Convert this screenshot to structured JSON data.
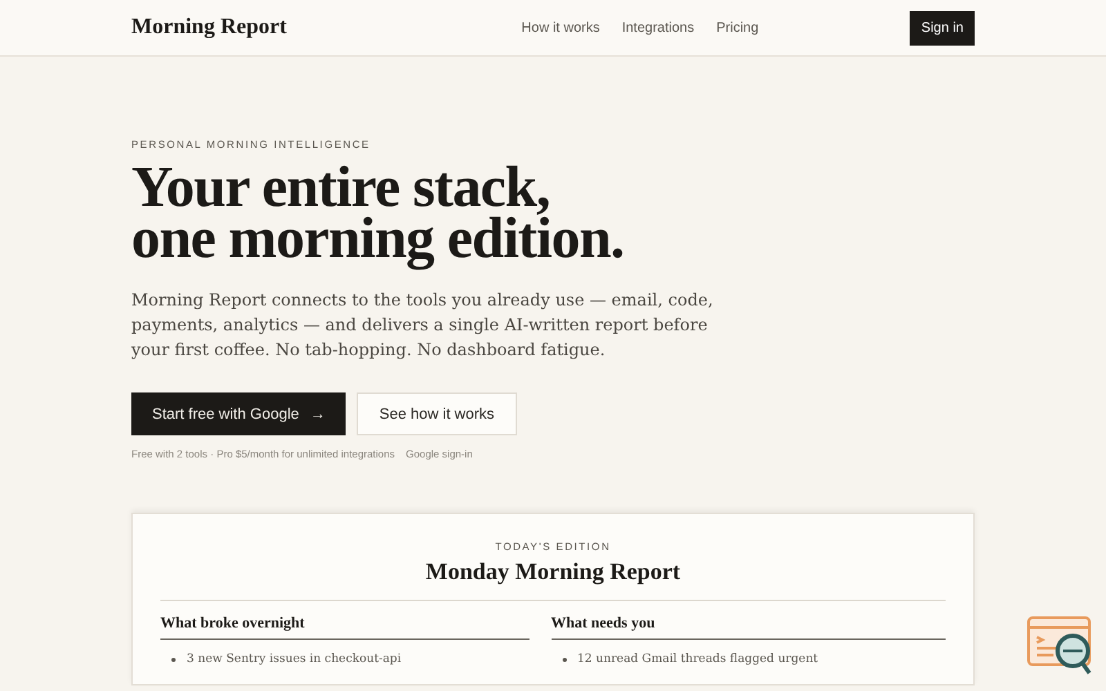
{
  "nav": {
    "brand": "Morning Report",
    "links": [
      "How it works",
      "Integrations",
      "Pricing"
    ],
    "sign_in": "Sign in"
  },
  "hero": {
    "eyebrow": "PERSONAL MORNING INTELLIGENCE",
    "headline": [
      "Your entire stack,",
      "one morning edition."
    ],
    "lede": "Morning Report connects to the tools you already use — email, code, payments, analytics — and delivers a single AI-written report before your first coffee. No tab-hopping. No dashboard fatigue.",
    "primary_button": "Start free with Google",
    "primary_arrow": "→",
    "secondary_button": "See how it works",
    "notes": [
      "Free with 2 tools · Pro $5/month for unlimited integrations",
      "Google sign-in"
    ]
  },
  "report": {
    "eyebrow": "TODAY'S EDITION",
    "title": "Monday Morning Report",
    "sections": [
      {
        "heading": "What broke overnight",
        "items": [
          "3 new Sentry issues in checkout-api"
        ]
      },
      {
        "heading": "What needs you",
        "items": [
          "12 unread Gmail threads flagged urgent"
        ]
      }
    ]
  }
}
